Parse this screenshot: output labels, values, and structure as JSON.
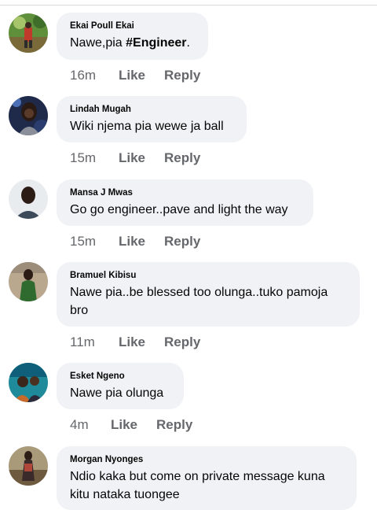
{
  "comments": [
    {
      "author": "Ekai Poull Ekai",
      "text_prefix": "Nawe,pia ",
      "text_tag": "#Engineer",
      "text_suffix": ".",
      "time": "16m",
      "like": "Like",
      "reply": "Reply"
    },
    {
      "author": "Lindah Mugah",
      "text": "Wiki njema pia wewe ja ball",
      "time": "15m",
      "like": "Like",
      "reply": "Reply"
    },
    {
      "author": "Mansa J Mwas",
      "text": "Go go engineer..pave and light the way",
      "time": "15m",
      "like": "Like",
      "reply": "Reply"
    },
    {
      "author": "Bramuel Kibisu",
      "text": "Nawe pia..be blessed too olunga..tuko pamoja bro",
      "time": "11m",
      "like": "Like",
      "reply": "Reply"
    },
    {
      "author": "Esket Ngeno",
      "text": "Nawe pia olunga",
      "time": "4m",
      "like": "Like",
      "reply": "Reply"
    },
    {
      "author": "Morgan Nyonges",
      "text": "Ndio kaka but come on private message kuna kitu nataka tuongee"
    }
  ]
}
